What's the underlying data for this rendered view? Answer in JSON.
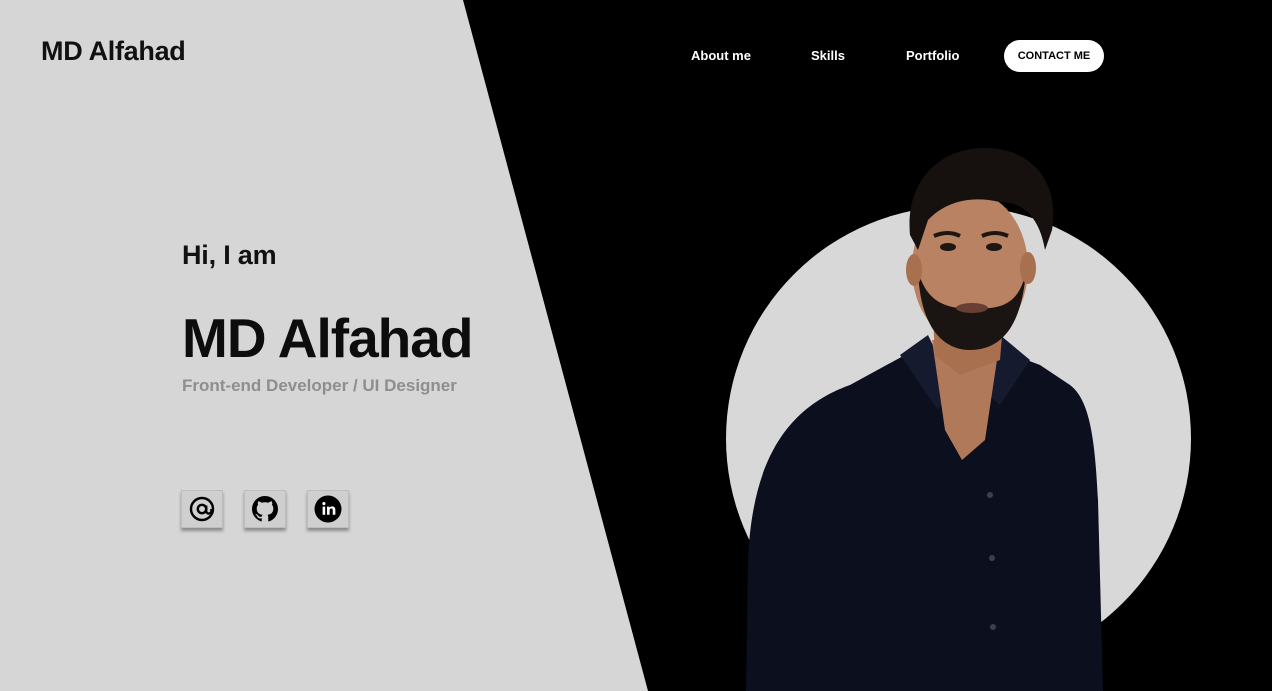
{
  "header": {
    "logo": "MD Alfahad",
    "nav": {
      "about": "About me",
      "skills": "Skills",
      "portfolio": "Portfolio",
      "contact": "CONTACT ME"
    }
  },
  "hero": {
    "greeting": "Hi, I am",
    "name": "MD Alfahad",
    "role": "Front-end Developer / UI Designer"
  },
  "socials": [
    {
      "icon": "at-sign-icon"
    },
    {
      "icon": "github-icon"
    },
    {
      "icon": "linkedin-icon"
    }
  ],
  "colors": {
    "left_panel": "#d6d6d6",
    "right_panel": "#000000",
    "contact_button_bg": "#ffffff",
    "role_text": "#8e8e8e",
    "photo_circle": "#d8d8d8"
  }
}
